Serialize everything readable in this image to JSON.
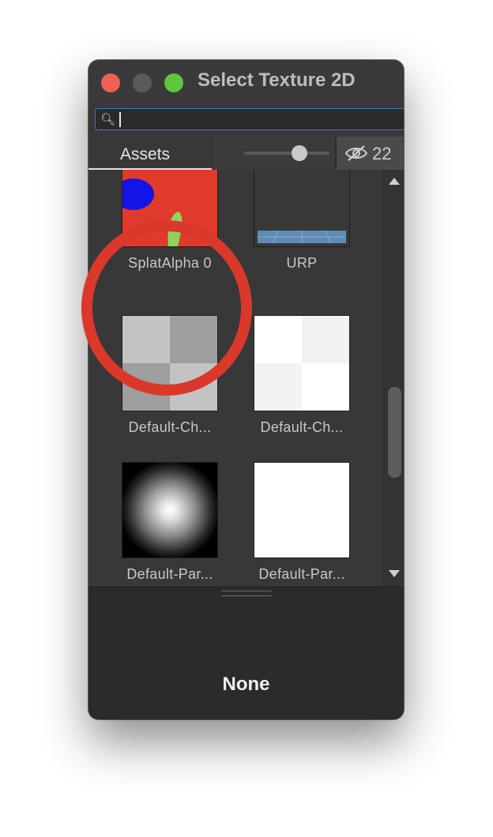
{
  "window": {
    "title": "Select Texture 2D"
  },
  "search": {
    "value": "",
    "placeholder": ""
  },
  "tabs": {
    "assets": "Assets"
  },
  "toolbar": {
    "hidden_count": "22",
    "thumbnail_size": 0.65
  },
  "assets": [
    {
      "label": "SplatAlpha 0",
      "icon": "splat-texture"
    },
    {
      "label": "URP",
      "icon": "grid-plane"
    },
    {
      "label": "Default-Ch...",
      "icon": "checker-grey"
    },
    {
      "label": "Default-Ch...",
      "icon": "checker-white"
    },
    {
      "label": "Default-Par...",
      "icon": "particle-radial"
    },
    {
      "label": "Default-Par...",
      "icon": "white-square"
    }
  ],
  "footer": {
    "selection": "None"
  },
  "colors": {
    "highlight_ring": "#d9382a",
    "search_focus": "#3f79c0"
  }
}
